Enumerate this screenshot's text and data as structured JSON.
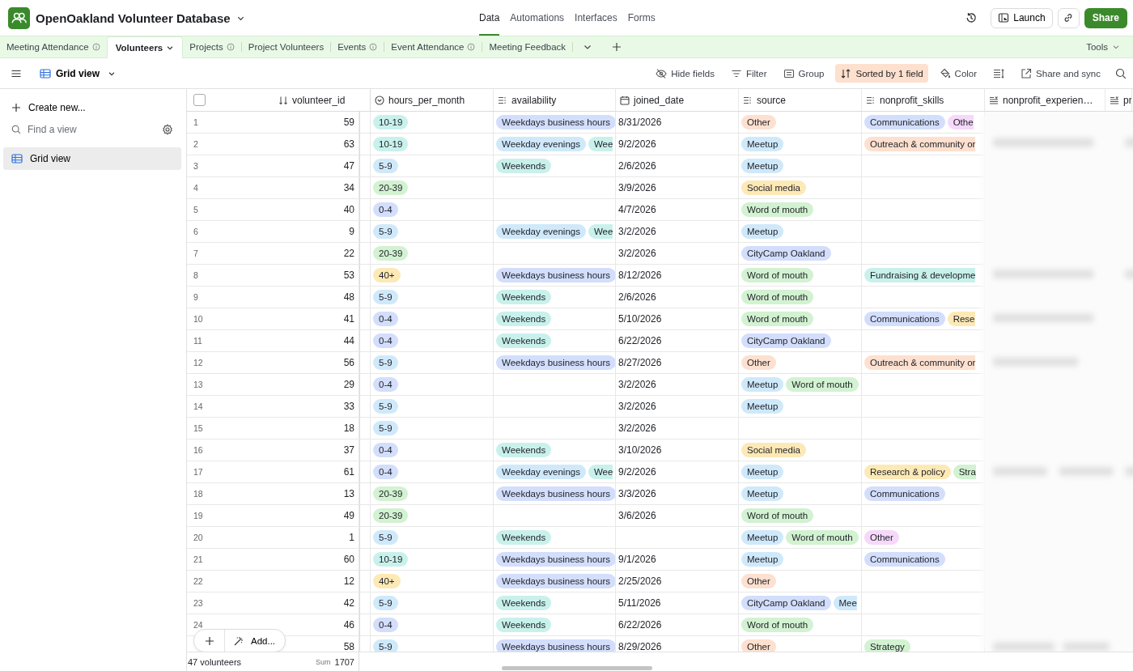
{
  "app": {
    "title": "OpenOakland Volunteer Database"
  },
  "nav": [
    {
      "label": "Data",
      "selected": true
    },
    {
      "label": "Automations",
      "selected": false
    },
    {
      "label": "Interfaces",
      "selected": false
    },
    {
      "label": "Forms",
      "selected": false
    }
  ],
  "header_actions": {
    "launch": "Launch",
    "share": "Share"
  },
  "tables": [
    {
      "label": "Meeting Attendance",
      "selected": false,
      "has_info": true
    },
    {
      "label": "Volunteers",
      "selected": true,
      "has_info": false
    },
    {
      "label": "Projects",
      "selected": false,
      "has_info": true
    },
    {
      "label": "Project Volunteers",
      "selected": false,
      "has_info": false
    },
    {
      "label": "Events",
      "selected": false,
      "has_info": true
    },
    {
      "label": "Event Attendance",
      "selected": false,
      "has_info": true
    },
    {
      "label": "Meeting Feedback",
      "selected": false,
      "has_info": false
    }
  ],
  "tools": "Tools",
  "view_name": "Grid view",
  "toolbar": [
    {
      "kind": "hide",
      "label": "Hide fields",
      "active": false
    },
    {
      "kind": "filter",
      "label": "Filter",
      "active": false
    },
    {
      "kind": "group",
      "label": "Group",
      "active": false
    },
    {
      "kind": "sort",
      "label": "Sorted by 1 field",
      "active": true
    },
    {
      "kind": "color",
      "label": "Color",
      "active": false
    },
    {
      "kind": "rowheight",
      "active": false
    },
    {
      "kind": "share",
      "label": "Share and sync",
      "active": false
    }
  ],
  "sidebar": {
    "create": "Create new...",
    "search": {
      "placeholder": "Find a view"
    },
    "views": [
      {
        "label": "Grid view",
        "selected": true
      }
    ]
  },
  "select_all": {
    "checked": false
  },
  "columns": [
    {
      "kind": "number",
      "label": "volunteer_id"
    },
    {
      "kind": "single",
      "label": "hours_per_month"
    },
    {
      "kind": "multi",
      "label": "availability"
    },
    {
      "kind": "date",
      "label": "joined_date"
    },
    {
      "kind": "multi",
      "label": "source"
    },
    {
      "kind": "multi",
      "label": "nonprofit_skills"
    },
    {
      "kind": "text",
      "label": "nonprofit_experien…"
    },
    {
      "kind": "text",
      "label": "pr"
    }
  ],
  "rows": [
    {
      "num": "1",
      "id": "59",
      "hours": {
        "text": "10-19",
        "color": "#c9f1ec"
      },
      "availability": [
        {
          "text": "Weekdays business hours",
          "color": "#d3defc",
          "cut": false
        }
      ],
      "joined_date": "8/31/2026",
      "source": [
        {
          "text": "Other",
          "color": "#fde0cf",
          "cut": false
        }
      ],
      "skills": [
        {
          "text": "Communications",
          "color": "#d3defc",
          "cut": false
        },
        {
          "text": "Othe",
          "color": "#f5d8fa",
          "cut": true
        }
      ]
    },
    {
      "num": "2",
      "id": "63",
      "hours": {
        "text": "10-19",
        "color": "#c9f1ec"
      },
      "availability": [
        {
          "text": "Weekday evenings",
          "color": "#cfe9fb",
          "cut": false
        },
        {
          "text": "Wee",
          "color": "#c9f1ec",
          "cut": true
        }
      ],
      "joined_date": "9/2/2026",
      "source": [
        {
          "text": "Meetup",
          "color": "#cfe9fb",
          "cut": false
        }
      ],
      "skills": [
        {
          "text": "Outreach & community or",
          "color": "#fde0cf",
          "cut": true
        }
      ]
    },
    {
      "num": "3",
      "id": "47",
      "hours": {
        "text": "5-9",
        "color": "#cfe9fb"
      },
      "availability": [
        {
          "text": "Weekends",
          "color": "#c9f1ec",
          "cut": false
        }
      ],
      "joined_date": "2/6/2026",
      "source": [
        {
          "text": "Meetup",
          "color": "#cfe9fb",
          "cut": false
        }
      ]
    },
    {
      "num": "4",
      "id": "34",
      "hours": {
        "text": "20-39",
        "color": "#d2f2d1"
      },
      "joined_date": "3/9/2026",
      "source": [
        {
          "text": "Social media",
          "color": "#fde9b6",
          "cut": false
        }
      ]
    },
    {
      "num": "5",
      "id": "40",
      "hours": {
        "text": "0-4",
        "color": "#d3defc"
      },
      "joined_date": "4/7/2026",
      "source": [
        {
          "text": "Word of mouth",
          "color": "#d2f2d1",
          "cut": false
        }
      ]
    },
    {
      "num": "6",
      "id": "9",
      "hours": {
        "text": "5-9",
        "color": "#cfe9fb"
      },
      "availability": [
        {
          "text": "Weekday evenings",
          "color": "#cfe9fb",
          "cut": false
        },
        {
          "text": "Wee",
          "color": "#c9f1ec",
          "cut": true
        }
      ],
      "joined_date": "3/2/2026",
      "source": [
        {
          "text": "Meetup",
          "color": "#cfe9fb",
          "cut": false
        }
      ]
    },
    {
      "num": "7",
      "id": "22",
      "hours": {
        "text": "20-39",
        "color": "#d2f2d1"
      },
      "joined_date": "3/2/2026",
      "source": [
        {
          "text": "CityCamp Oakland",
          "color": "#d3defc",
          "cut": false
        }
      ]
    },
    {
      "num": "8",
      "id": "53",
      "hours": {
        "text": "40+",
        "color": "#fde9b6"
      },
      "availability": [
        {
          "text": "Weekdays business hours",
          "color": "#d3defc",
          "cut": false
        }
      ],
      "joined_date": "8/12/2026",
      "source": [
        {
          "text": "Word of mouth",
          "color": "#d2f2d1",
          "cut": false
        }
      ],
      "skills": [
        {
          "text": "Fundraising & developme",
          "color": "#c9f1ec",
          "cut": true
        }
      ]
    },
    {
      "num": "9",
      "id": "48",
      "hours": {
        "text": "5-9",
        "color": "#cfe9fb"
      },
      "availability": [
        {
          "text": "Weekends",
          "color": "#c9f1ec",
          "cut": false
        }
      ],
      "joined_date": "2/6/2026",
      "source": [
        {
          "text": "Word of mouth",
          "color": "#d2f2d1",
          "cut": false
        }
      ]
    },
    {
      "num": "10",
      "id": "41",
      "hours": {
        "text": "0-4",
        "color": "#d3defc"
      },
      "availability": [
        {
          "text": "Weekends",
          "color": "#c9f1ec",
          "cut": false
        }
      ],
      "joined_date": "5/10/2026",
      "source": [
        {
          "text": "Word of mouth",
          "color": "#d2f2d1",
          "cut": false
        }
      ],
      "skills": [
        {
          "text": "Communications",
          "color": "#d3defc",
          "cut": false
        },
        {
          "text": "Rese",
          "color": "#fde9b6",
          "cut": true
        }
      ]
    },
    {
      "num": "11",
      "id": "44",
      "hours": {
        "text": "0-4",
        "color": "#d3defc"
      },
      "availability": [
        {
          "text": "Weekends",
          "color": "#c9f1ec",
          "cut": false
        }
      ],
      "joined_date": "6/22/2026",
      "source": [
        {
          "text": "CityCamp Oakland",
          "color": "#d3defc",
          "cut": false
        }
      ]
    },
    {
      "num": "12",
      "id": "56",
      "hours": {
        "text": "5-9",
        "color": "#cfe9fb"
      },
      "availability": [
        {
          "text": "Weekdays business hours",
          "color": "#d3defc",
          "cut": false
        }
      ],
      "joined_date": "8/27/2026",
      "source": [
        {
          "text": "Other",
          "color": "#fde0cf",
          "cut": false
        }
      ],
      "skills": [
        {
          "text": "Outreach & community or",
          "color": "#fde0cf",
          "cut": true
        }
      ]
    },
    {
      "num": "13",
      "id": "29",
      "hours": {
        "text": "0-4",
        "color": "#d3defc"
      },
      "joined_date": "3/2/2026",
      "source": [
        {
          "text": "Meetup",
          "color": "#cfe9fb",
          "cut": false
        },
        {
          "text": "Word of mouth",
          "color": "#d2f2d1",
          "cut": false
        }
      ]
    },
    {
      "num": "14",
      "id": "33",
      "hours": {
        "text": "5-9",
        "color": "#cfe9fb"
      },
      "joined_date": "3/2/2026",
      "source": [
        {
          "text": "Meetup",
          "color": "#cfe9fb",
          "cut": false
        }
      ]
    },
    {
      "num": "15",
      "id": "18",
      "hours": {
        "text": "5-9",
        "color": "#cfe9fb"
      },
      "joined_date": "3/2/2026"
    },
    {
      "num": "16",
      "id": "37",
      "hours": {
        "text": "0-4",
        "color": "#d3defc"
      },
      "availability": [
        {
          "text": "Weekends",
          "color": "#c9f1ec",
          "cut": false
        }
      ],
      "joined_date": "3/10/2026",
      "source": [
        {
          "text": "Social media",
          "color": "#fde9b6",
          "cut": false
        }
      ]
    },
    {
      "num": "17",
      "id": "61",
      "hours": {
        "text": "0-4",
        "color": "#d3defc"
      },
      "availability": [
        {
          "text": "Weekday evenings",
          "color": "#cfe9fb",
          "cut": false
        },
        {
          "text": "Wee",
          "color": "#c9f1ec",
          "cut": true
        }
      ],
      "joined_date": "9/2/2026",
      "source": [
        {
          "text": "Meetup",
          "color": "#cfe9fb",
          "cut": false
        }
      ],
      "skills": [
        {
          "text": "Research & policy",
          "color": "#fde9b6",
          "cut": false
        },
        {
          "text": "Stra",
          "color": "#d2f2d1",
          "cut": true
        }
      ]
    },
    {
      "num": "18",
      "id": "13",
      "hours": {
        "text": "20-39",
        "color": "#d2f2d1"
      },
      "availability": [
        {
          "text": "Weekdays business hours",
          "color": "#d3defc",
          "cut": false
        }
      ],
      "joined_date": "3/3/2026",
      "source": [
        {
          "text": "Meetup",
          "color": "#cfe9fb",
          "cut": false
        }
      ],
      "skills": [
        {
          "text": "Communications",
          "color": "#d3defc",
          "cut": false
        }
      ]
    },
    {
      "num": "19",
      "id": "49",
      "hours": {
        "text": "20-39",
        "color": "#d2f2d1"
      },
      "joined_date": "3/6/2026",
      "source": [
        {
          "text": "Word of mouth",
          "color": "#d2f2d1",
          "cut": false
        }
      ]
    },
    {
      "num": "20",
      "id": "1",
      "hours": {
        "text": "5-9",
        "color": "#cfe9fb"
      },
      "availability": [
        {
          "text": "Weekends",
          "color": "#c9f1ec",
          "cut": false
        }
      ],
      "source": [
        {
          "text": "Meetup",
          "color": "#cfe9fb",
          "cut": false
        },
        {
          "text": "Word of mouth",
          "color": "#d2f2d1",
          "cut": false
        }
      ],
      "skills": [
        {
          "text": "Other",
          "color": "#f5d8fa",
          "cut": false
        }
      ]
    },
    {
      "num": "21",
      "id": "60",
      "hours": {
        "text": "10-19",
        "color": "#c9f1ec"
      },
      "availability": [
        {
          "text": "Weekdays business hours",
          "color": "#d3defc",
          "cut": false
        }
      ],
      "joined_date": "9/1/2026",
      "source": [
        {
          "text": "Meetup",
          "color": "#cfe9fb",
          "cut": false
        }
      ],
      "skills": [
        {
          "text": "Communications",
          "color": "#d3defc",
          "cut": false
        }
      ]
    },
    {
      "num": "22",
      "id": "12",
      "hours": {
        "text": "40+",
        "color": "#fde9b6"
      },
      "availability": [
        {
          "text": "Weekdays business hours",
          "color": "#d3defc",
          "cut": false
        }
      ],
      "joined_date": "2/25/2026",
      "source": [
        {
          "text": "Other",
          "color": "#fde0cf",
          "cut": false
        }
      ]
    },
    {
      "num": "23",
      "id": "42",
      "hours": {
        "text": "5-9",
        "color": "#cfe9fb"
      },
      "availability": [
        {
          "text": "Weekends",
          "color": "#c9f1ec",
          "cut": false
        }
      ],
      "joined_date": "5/11/2026",
      "source": [
        {
          "text": "CityCamp Oakland",
          "color": "#d3defc",
          "cut": false
        },
        {
          "text": "Mee",
          "color": "#cfe9fb",
          "cut": true
        }
      ]
    },
    {
      "num": "24",
      "id": "46",
      "hours": {
        "text": "0-4",
        "color": "#d3defc"
      },
      "availability": [
        {
          "text": "Weekends",
          "color": "#c9f1ec",
          "cut": false
        }
      ],
      "joined_date": "6/22/2026",
      "source": [
        {
          "text": "Word of mouth",
          "color": "#d2f2d1",
          "cut": false
        }
      ]
    },
    {
      "id": "58",
      "hours": {
        "text": "5-9",
        "color": "#cfe9fb"
      },
      "availability": [
        {
          "text": "Weekdays business hours",
          "color": "#d3defc",
          "cut": false
        }
      ],
      "joined_date": "8/29/2026",
      "source": [
        {
          "text": "Other",
          "color": "#fde0cf",
          "cut": false
        }
      ],
      "skills": [
        {
          "text": "Strategy",
          "color": "#d2f2d1",
          "cut": false
        }
      ]
    }
  ],
  "footer": {
    "count": "47 volunteers",
    "sum_label": "Sum",
    "sum": "1707",
    "add": "Add..."
  }
}
